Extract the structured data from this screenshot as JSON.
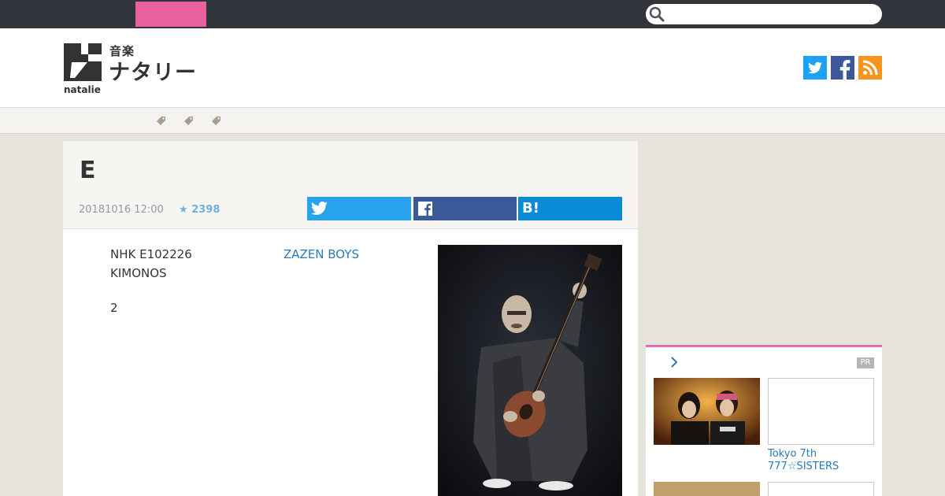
{
  "header": {
    "logo_small": "音楽",
    "logo_big": "ナタリー",
    "logo_sub": "natalie",
    "social_icons": [
      "twitter-icon",
      "facebook-icon",
      "rss-icon"
    ]
  },
  "search": {
    "placeholder": ""
  },
  "article": {
    "title": "E",
    "date": "20181016 12:00",
    "star_count": "2398",
    "share_buttons": [
      "twitter",
      "facebook",
      "hatena"
    ],
    "hatena_label": "B!",
    "body_line1": "NHK E102226",
    "body_line2": "KIMONOS",
    "body_line3": "2",
    "link_text": "ZAZEN BOYS"
  },
  "sidebar": {
    "pr_label": "PR",
    "item_title": "Tokyo 7th 777☆SISTERS"
  },
  "colors": {
    "topbar": "#31343b",
    "accent_pink": "#e9609f",
    "link": "#2a7ab8",
    "star": "#6cb1dd"
  }
}
